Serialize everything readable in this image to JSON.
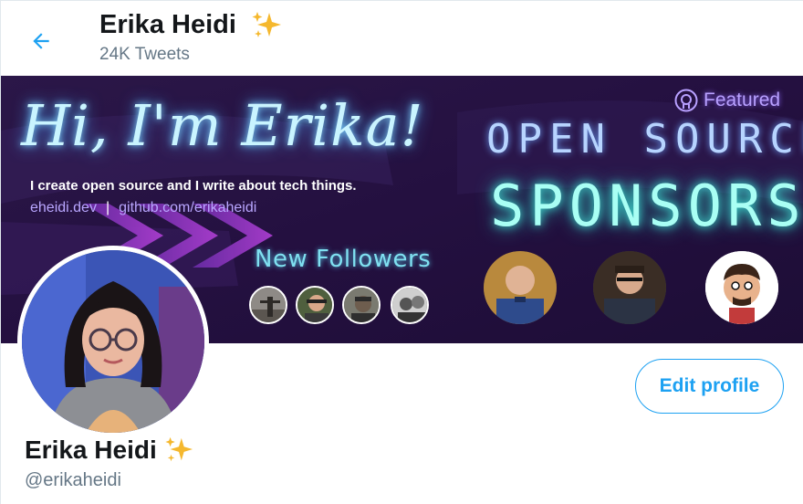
{
  "header": {
    "name": "Erika Heidi",
    "tweet_count": "24K Tweets"
  },
  "banner": {
    "greeting": "Hi, I'm Erika!",
    "tagline": "I create open source and I write about tech things.",
    "link_site": "eheidi.dev",
    "link_separator": "|",
    "link_github": "github.com/erikaheidi",
    "new_followers_label": "New Followers",
    "featured_label": "Featured",
    "open_source_label": "OPEN SOURCE",
    "sponsors_label": "SPONSORS"
  },
  "profile": {
    "name": "Erika Heidi",
    "handle": "@erikaheidi",
    "edit_button": "Edit profile"
  },
  "colors": {
    "accent": "#1da1f2",
    "secondary_text": "#657786",
    "banner_bg": "#2a1445"
  },
  "icons": {
    "back": "arrow-left-icon",
    "sparkles": "sparkles-icon",
    "featured": "github-icon"
  }
}
